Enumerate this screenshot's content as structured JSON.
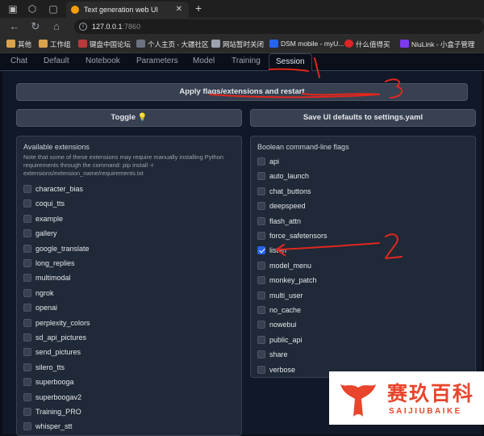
{
  "browser": {
    "tab_title": "Text generation web UI",
    "url_host": "127.0.0.1",
    "url_port": ":7860",
    "bookmarks": [
      "其他",
      "工作组",
      "键盘中国论坛",
      "个人主页 - 大疆社区",
      "网站暂时关闭",
      "DSM mobile - myU...",
      "什么值得买",
      "NiuLink - 小盒子管理"
    ]
  },
  "tabs": [
    "Chat",
    "Default",
    "Notebook",
    "Parameters",
    "Model",
    "Training",
    "Session"
  ],
  "active_tab": "Session",
  "session": {
    "apply_button": "Apply flags/extensions and restart",
    "toggle_button": "Toggle 💡",
    "save_button": "Save UI defaults to settings.yaml",
    "extensions": {
      "title": "Available extensions",
      "note": "Note that some of these extensions may require manually installing Python requirements through the command: pip install -r extensions/extension_name/requirements.txt",
      "items": [
        "character_bias",
        "coqui_tts",
        "example",
        "gallery",
        "google_translate",
        "long_replies",
        "multimodal",
        "ngrok",
        "openai",
        "perplexity_colors",
        "sd_api_pictures",
        "send_pictures",
        "silero_tts",
        "superbooga",
        "superboogav2",
        "Training_PRO",
        "whisper_stt"
      ]
    },
    "flags": {
      "title": "Boolean command-line flags",
      "items": [
        "api",
        "auto_launch",
        "chat_buttons",
        "deepspeed",
        "flash_attn",
        "force_safetensors",
        "listen",
        "model_menu",
        "monkey_patch",
        "multi_user",
        "no_cache",
        "nowebui",
        "public_api",
        "share",
        "verbose"
      ],
      "checked": [
        "listen"
      ]
    }
  },
  "annotations": {
    "color": "#e0271e",
    "marks": [
      "1",
      "2",
      "3"
    ]
  },
  "watermark": {
    "title": "赛玖百科",
    "subtitle": "SAIJIUBAIKE",
    "color": "#e8452c"
  }
}
